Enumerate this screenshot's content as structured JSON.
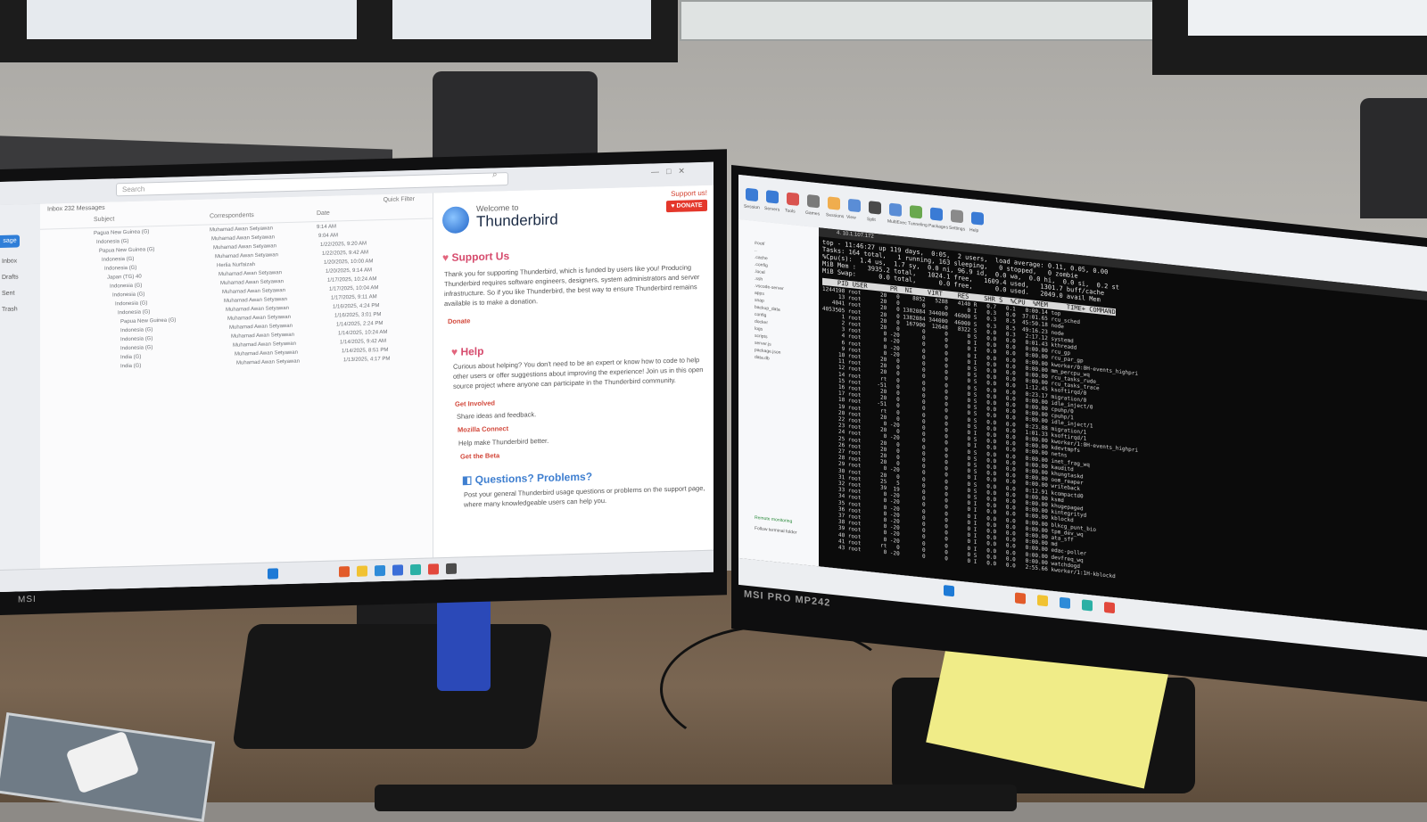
{
  "scene": {
    "description_colors": {
      "thunderbird_accent": "#d64b6d",
      "donate_red": "#e4372b",
      "terminal_bg": "#0b0b0b",
      "terminal_fg": "#e3e3e3",
      "terminal_green": "#4fc94f"
    }
  },
  "thunderbird": {
    "search_placeholder": "Search",
    "compose_label": "sage",
    "folders": [
      "Inbox",
      "Drafts",
      "Sent",
      "Trash"
    ],
    "folder_summary": "Inbox   232 Messages",
    "quick_filter": "Quick Filter",
    "columns": {
      "subject": "Subject",
      "correspondents": "Correspondents",
      "date": "Date"
    },
    "rows": [
      {
        "subject": "Pagua New Guinea (G)",
        "from": "Muhamad Awan Setyawan",
        "date": "9:14 AM"
      },
      {
        "subject": "Indonesia (G)",
        "from": "Muhamad Awan Setyawan",
        "date": "9:04 AM"
      },
      {
        "subject": "Papua New Guinea (G)",
        "from": "Muhamad Awan Setyawan",
        "date": "1/22/2025, 9:20 AM"
      },
      {
        "subject": "Indonesia (G)",
        "from": "Muhamad Awan Setyawan",
        "date": "1/22/2025, 9:42 AM"
      },
      {
        "subject": "Indonesia (G)",
        "from": "Herlia Nurfaizah",
        "date": "1/20/2025, 10:00 AM"
      },
      {
        "subject": "Japan (TG) 40",
        "from": "Muhamad Awan Setyawan",
        "date": "1/20/2025, 9:14 AM"
      },
      {
        "subject": "Indonesia (G)",
        "from": "Muhamad Awan Setyawan",
        "date": "1/17/2025, 10:24 AM"
      },
      {
        "subject": "Indonesia (G)",
        "from": "Muhamad Awan Setyawan",
        "date": "1/17/2025, 10:04 AM"
      },
      {
        "subject": "Indonesia (G)",
        "from": "Muhamad Awan Setyawan",
        "date": "1/17/2025, 9:11 AM"
      },
      {
        "subject": "Indonesia (G)",
        "from": "Muhamad Awan Setyawan",
        "date": "1/16/2025, 4:24 PM"
      },
      {
        "subject": "Papua New Guinea (G)",
        "from": "Muhamad Awan Setyawan",
        "date": "1/16/2025, 3:01 PM"
      },
      {
        "subject": "Indonesia (G)",
        "from": "Muhamad Awan Setyawan",
        "date": "1/14/2025, 2:24 PM"
      },
      {
        "subject": "Indonesia (G)",
        "from": "Muhamad Awan Setyawan",
        "date": "1/14/2025, 10:24 AM"
      },
      {
        "subject": "Indonesia (G)",
        "from": "Muhamad Awan Setyawan",
        "date": "1/14/2025, 9:42 AM"
      },
      {
        "subject": "India (G)",
        "from": "Muhamad Awan Setyawan",
        "date": "1/14/2025, 8:51 PM"
      },
      {
        "subject": "India (G)",
        "from": "Muhamad Awan Setyawan",
        "date": "1/13/2025, 4:17 PM"
      }
    ],
    "welcome": {
      "welcome_to": "Welcome to",
      "title": "Thunderbird",
      "support_link": "Support us!",
      "donate_button": "DONATE",
      "support_heading": "Support Us",
      "support_text": "Thank you for supporting Thunderbird, which is funded by users like you! Producing Thunderbird requires software engineers, designers, system administrators and server infrastructure. So if you like Thunderbird, the best way to ensure Thunderbird remains available is to make a donation.",
      "donate_link": "Donate",
      "help_heading": "Help",
      "help_text": "Curious about helping? You don't need to be an expert or know how to code to help other users or offer suggestions about improving the experience! Join us in this open source project where anyone can participate in the Thunderbird community.",
      "get_involved_link": "Get Involved",
      "get_involved_desc": "Share ideas and feedback.",
      "mozilla_connect_link": "Mozilla Connect",
      "mozilla_connect_desc": "Help make Thunderbird better.",
      "beta_link": "Get the Beta",
      "questions_heading": "Questions? Problems?",
      "questions_text": "Post your general Thunderbird usage questions or problems on the support page, where many knowledgeable users can help you."
    }
  },
  "terminal": {
    "tab_title": "4. 10.1.107.172",
    "header": [
      "top - 11:46:27 up 119 days,  0:05,  2 users,  load average: 0.11, 0.05, 0.00",
      "Tasks: 164 total,   1 running, 163 sleeping,   0 stopped,   0 zombie",
      "%Cpu(s):  1.4 us,  1.7 sy,  0.0 ni, 96.9 id,  0.0 wa,  0.0 hi,  0.0 si,  0.2 st",
      "MiB Mem :   3935.2 total,   1024.1 free,   1609.4 used,   1301.7 buff/cache",
      "MiB Swap:      0.0 total,      0.0 free,      0.0 used.   2049.0 avail Mem"
    ],
    "column_header": "    PID USER      PR  NI    VIRT    RES    SHR S  %CPU  %MEM     TIME+ COMMAND",
    "processes": [
      "1244198 root      20   0    8852   5288   4140 R   0.7   0.1   0:00.14 top",
      "     13 root      20   0       0      0      0 I   0.3   0.0  37:01.65 rcu_sched",
      "   4041 root      20   0 1382084 344000  46000 S   0.3   8.5  45:50.18 node",
      "4053505 root      20   0 1382084 344000  46000 S   0.3   8.5  49:16.23 node",
      "      1 root      20   0  167900  12648   8322 S   0.0   0.3   2:17.12 systemd",
      "      2 root      20   0       0      0      0 S   0.0   0.0   0:01.43 kthreadd",
      "      3 root       0 -20       0      0      0 I   0.0   0.0   0:00.00 rcu_gp",
      "      4 root       0 -20       0      0      0 I   0.0   0.0   0:00.00 rcu_par_gp",
      "      6 root       0 -20       0      0      0 I   0.0   0.0   0:00.00 kworker/0:0H-events_highpri",
      "      9 root       0 -20       0      0      0 I   0.0   0.0   0:00.00 mm_percpu_wq",
      "     10 root      20   0       0      0      0 S   0.0   0.0   0:00.00 rcu_tasks_rude_",
      "     11 root      20   0       0      0      0 S   0.0   0.0   0:00.00 rcu_tasks_trace",
      "     12 root      20   0       0      0      0 S   0.0   0.0   1:12.45 ksoftirqd/0",
      "     14 root      rt   0       0      0      0 S   0.0   0.0   0:23.17 migration/0",
      "     15 root     -51   0       0      0      0 S   0.0   0.0   0:00.00 idle_inject/0",
      "     16 root      20   0       0      0      0 S   0.0   0.0   0:00.00 cpuhp/0",
      "     17 root      20   0       0      0      0 S   0.0   0.0   0:00.00 cpuhp/1",
      "     18 root     -51   0       0      0      0 S   0.0   0.0   0:00.00 idle_inject/1",
      "     19 root      rt   0       0      0      0 S   0.0   0.0   0:23.88 migration/1",
      "     20 root      20   0       0      0      0 S   0.0   0.0   1:01.33 ksoftirqd/1",
      "     22 root       0 -20       0      0      0 I   0.0   0.0   0:00.00 kworker/1:0H-events_highpri",
      "     23 root      20   0       0      0      0 S   0.0   0.0   0:00.00 kdevtmpfs",
      "     24 root       0 -20       0      0      0 I   0.0   0.0   0:00.00 netns",
      "     25 root      20   0       0      0      0 S   0.0   0.0   0:00.00 inet_frag_wq",
      "     26 root      20   0       0      0      0 S   0.0   0.0   0:00.00 kauditd",
      "     27 root      20   0       0      0      0 S   0.0   0.0   0:00.00 khungtaskd",
      "     28 root      20   0       0      0      0 S   0.0   0.0   0:00.00 oom_reaper",
      "     29 root       0 -20       0      0      0 I   0.0   0.0   0:00.00 writeback",
      "     30 root      20   0       0      0      0 S   0.0   0.0   0:12.91 kcompactd0",
      "     31 root      25   5       0      0      0 S   0.0   0.0   0:00.00 ksmd",
      "     32 root      39  19       0      0      0 S   0.0   0.0   0:00.00 khugepaged",
      "     33 root       0 -20       0      0      0 I   0.0   0.0   0:00.00 kintegrityd",
      "     34 root       0 -20       0      0      0 I   0.0   0.0   0:00.00 kblockd",
      "     35 root       0 -20       0      0      0 I   0.0   0.0   0:00.00 blkcg_punt_bio",
      "     36 root       0 -20       0      0      0 I   0.0   0.0   0:00.00 tpm_dev_wq",
      "     37 root       0 -20       0      0      0 I   0.0   0.0   0:00.00 ata_sff",
      "     38 root       0 -20       0      0      0 I   0.0   0.0   0:00.00 md",
      "     39 root       0 -20       0      0      0 I   0.0   0.0   0:00.00 edac-poller",
      "     40 root       0 -20       0      0      0 I   0.0   0.0   0:00.00 devfreq_wq",
      "     41 root      rt   0       0      0      0 S   0.0   0.0   0:00.00 watchdogd",
      "     43 root       0 -20       0      0      0 I   0.0   0.0   2:55.66 kworker/1:1H-kblockd"
    ]
  },
  "mobaxterm": {
    "ribbon": [
      "Session",
      "Servers",
      "Tools",
      "Games",
      "Sessions",
      "View",
      "Split",
      "MultiExec",
      "Tunneling",
      "Packages",
      "Settings",
      "Help"
    ],
    "tree": [
      "/root/",
      "..",
      ".cache",
      ".config",
      ".local",
      ".ssh",
      ".vscode-server",
      "apps",
      "snap",
      "backup_data",
      "config",
      "docker",
      "logs",
      "scripts",
      "server.js",
      "package.json",
      "data.db"
    ],
    "footer": [
      "Remote monitoring",
      "Follow terminal folder"
    ]
  },
  "hardware": {
    "left_brand": "MSI",
    "right_brand": "MSI PRO MP242"
  }
}
